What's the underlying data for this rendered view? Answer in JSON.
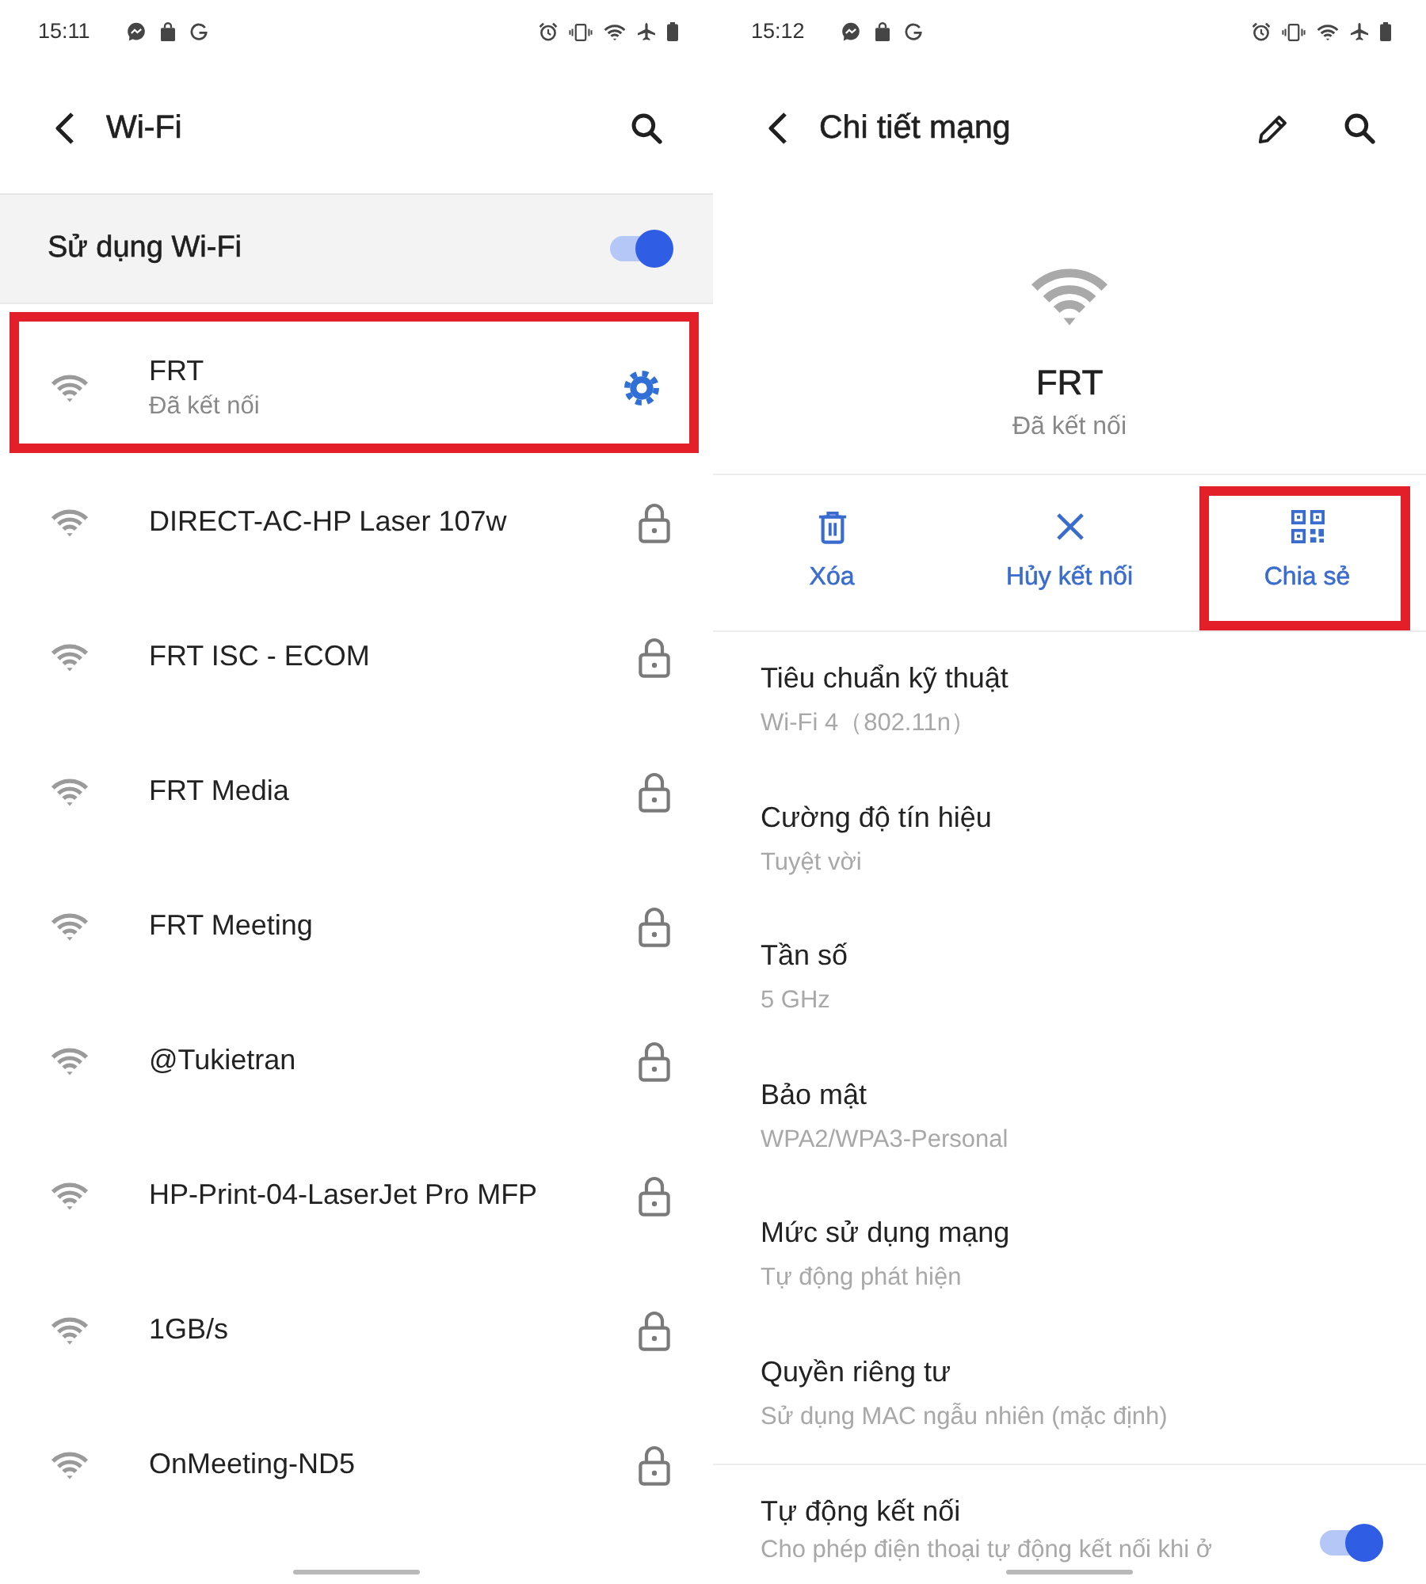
{
  "wifi_screen": {
    "status_bar": {
      "time": "15:11"
    },
    "title": "Wi-Fi",
    "wifi_switch": {
      "label": "Sử dụng Wi-Fi",
      "on": true
    },
    "networks": [
      {
        "name": "FRT",
        "status": "Đã kết nối",
        "kind": "connected",
        "highlighted": true
      },
      {
        "name": "DIRECT-AC-HP Laser 107w",
        "kind": "secured",
        "highlighted": false
      },
      {
        "name": "FRT ISC - ECOM",
        "kind": "secured",
        "highlighted": false
      },
      {
        "name": "FRT Media",
        "kind": "secured",
        "highlighted": false
      },
      {
        "name": "FRT Meeting",
        "kind": "secured",
        "highlighted": false
      },
      {
        "name": "@Tukietran",
        "kind": "secured",
        "highlighted": false
      },
      {
        "name": "HP-Print-04-LaserJet Pro MFP",
        "kind": "secured",
        "highlighted": false
      },
      {
        "name": "1GB/s",
        "kind": "secured",
        "highlighted": false
      },
      {
        "name": "OnMeeting-ND5",
        "kind": "secured",
        "highlighted": false
      }
    ]
  },
  "details_screen": {
    "status_bar": {
      "time": "15:12"
    },
    "title": "Chi tiết mạng",
    "network": {
      "name": "FRT",
      "status": "Đã kết nối"
    },
    "actions": [
      {
        "label": "Xóa",
        "kind": "delete",
        "highlighted": false
      },
      {
        "label": "Hủy kết nối",
        "kind": "disconnect",
        "highlighted": false
      },
      {
        "label": "Chia sẻ",
        "kind": "share",
        "highlighted": true
      }
    ],
    "details": [
      {
        "title": "Tiêu chuẩn kỹ thuật",
        "value": "Wi-Fi 4（802.11n）"
      },
      {
        "title": "Cường độ tín hiệu",
        "value": "Tuyệt vời"
      },
      {
        "title": "Tần số",
        "value": "5 GHz"
      },
      {
        "title": "Bảo mật",
        "value": "WPA2/WPA3-Personal"
      },
      {
        "title": "Mức sử dụng mạng",
        "value": "Tự động phát hiện"
      },
      {
        "title": "Quyền riêng tư",
        "value": "Sử dụng MAC ngẫu nhiên (mặc định)"
      }
    ],
    "auto_connect": {
      "label": "Tự động kết nối",
      "description": "Cho phép điện thoại tự động kết nối khi ở",
      "on": true
    }
  }
}
